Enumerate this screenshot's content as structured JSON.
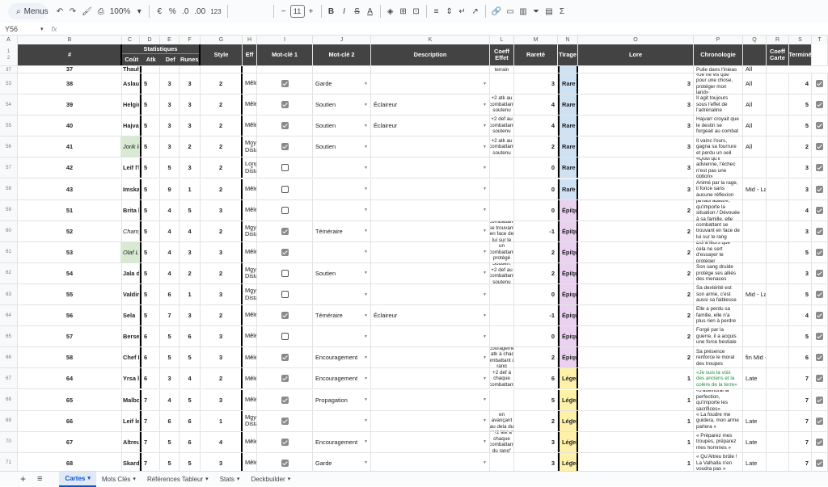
{
  "toolbar": {
    "search": "Menus",
    "zoom": "100%",
    "currency": "€",
    "percent": "%",
    "dec_less": ".0",
    "dec_more": ".00",
    "format_123": "123",
    "font_size": "11",
    "bold": "B",
    "italic": "I",
    "strike": "S",
    "textcolor": "A",
    "sigma": "Σ"
  },
  "formula": {
    "cell_ref": "Y56",
    "fx": "fx"
  },
  "columns": [
    "A",
    "B",
    "C",
    "D",
    "E",
    "F",
    "G",
    "H",
    "I",
    "J",
    "K",
    "L",
    "M",
    "N",
    "O",
    "P",
    "Q",
    "R",
    "S",
    "T"
  ],
  "header": {
    "row1": "1",
    "row2": "2",
    "num": "#",
    "nom": "Nom",
    "stats": "Statistiques",
    "cout": "Coût",
    "atk": "Atk",
    "def": "Def",
    "runes": "Runes",
    "style": "Style",
    "eff": "Eff",
    "mot1": "Mot-clé 1",
    "mot2": "Mot-clé 2",
    "desc": "Description",
    "coeff_effet": "Coeff Effet",
    "rarete": "Rareté",
    "tirage": "Tirage",
    "lore": "Lore",
    "chrono": "Chronologie",
    "coeff_carte": "Coeff Carte",
    "termine": "Terminé"
  },
  "partial_top": {
    "rownum": "37",
    "num": "37",
    "nom": "Thauhu la Charmante",
    "desc": "après avoir phase, afin que le combattant dans son terrain",
    "lore": "Pulie dans l'inieas",
    "chrono": "All"
  },
  "rows": [
    {
      "rownum": "53",
      "num": "38",
      "nom": "Aslaug",
      "cout": "5",
      "atk": "3",
      "def": "3",
      "runes": "2",
      "style": "Mêlée",
      "eff": true,
      "mot1": "Garde",
      "mot2": "",
      "desc": "",
      "coeff": "3",
      "rarete": "Rare",
      "tirage": "3",
      "lore": "«Je ne vis que pour une chose, protéger mon land»",
      "chrono": "All",
      "coeffc": "4",
      "done": true
    },
    {
      "rownum": "54",
      "num": "39",
      "nom": "Helgird le précipité",
      "cout": "5",
      "atk": "3",
      "def": "3",
      "runes": "2",
      "style": "Mêlée",
      "eff": true,
      "mot1": "Soutien",
      "mot2": "Éclaireur",
      "desc": "+2 atk au combattant soutenu",
      "coeff": "4",
      "rarete": "Rare",
      "tirage": "3",
      "lore": "Il agit toujours sous l'effet de l'adrénaline",
      "chrono": "All",
      "coeffc": "5",
      "done": true
    },
    {
      "rownum": "55",
      "num": "40",
      "nom": "Hajvarr",
      "cout": "5",
      "atk": "3",
      "def": "3",
      "runes": "2",
      "style": "Mêlée",
      "eff": true,
      "mot1": "Soutien",
      "mot2": "Éclaireur",
      "desc": "+2 def au combattant soutenu",
      "coeff": "4",
      "rarete": "Rare",
      "tirage": "3",
      "lore": "Hajvarr croyait que le destin se forgeait au combat",
      "chrono": "All",
      "coeffc": "5",
      "done": true
    },
    {
      "rownum": "56",
      "num": "41",
      "nom": "Jorik le Vaillant",
      "cout": "5",
      "atk": "3",
      "def": "2",
      "runes": "2",
      "style": "Moyenne Distance",
      "eff": true,
      "mot1": "Soutien",
      "mot2": "",
      "desc": "+2 atk au combattant soutenu",
      "coeff": "2",
      "rarete": "Rare",
      "tirage": "3",
      "lore": "Il vainc l'ours, gagna sa fourrure et perdu un oeil",
      "chrono": "All",
      "coeffc": "2",
      "done": true,
      "italic": true,
      "green": true
    },
    {
      "rownum": "57",
      "num": "42",
      "nom": "Leif l'héritier",
      "cout": "5",
      "atk": "5",
      "def": "3",
      "runes": "2",
      "style": "Longue Distance",
      "eff": false,
      "mot1": "",
      "mot2": "",
      "desc": "",
      "coeff": "0",
      "rarete": "Rare",
      "tirage": "3",
      "lore": "«Quoi qu'il advienne, l'échec n'est pas une option»",
      "chrono": "",
      "coeffc": "3",
      "done": true
    },
    {
      "rownum": "58",
      "num": "43",
      "nom": "Imskar l'arrogant",
      "cout": "5",
      "atk": "9",
      "def": "1",
      "runes": "2",
      "style": "Mêlée",
      "eff": false,
      "mot1": "",
      "mot2": "",
      "desc": "",
      "coeff": "0",
      "rarete": "Rare",
      "tirage": "3",
      "lore": "Animé par la rage, il fonce sans aucune réflexion",
      "chrono": "Mid - Late",
      "coeffc": "3",
      "done": true
    },
    {
      "rownum": "59",
      "num": "51",
      "nom": "Brita l'Inflexible",
      "cout": "5",
      "atk": "4",
      "def": "5",
      "runes": "3",
      "style": "Mêlée",
      "eff": false,
      "mot1": "",
      "mot2": "",
      "desc": "",
      "coeff": "0",
      "rarete": "Épique",
      "tirage": "2",
      "lore": "Ne se laisse jamais abattre, qu'importe la situation / Dévouée à sa famille, elle l'honore au combat",
      "chrono": "",
      "coeffc": "4",
      "done": true
    },
    {
      "rownum": "60",
      "num": "52",
      "nom": "Champion Njal",
      "cout": "5",
      "atk": "4",
      "def": "4",
      "runes": "2",
      "style": "Moyenne Distance",
      "eff": true,
      "mot1": "Téméraire",
      "mot2": "",
      "desc": "Pousse en avant le combattant se trouvant en face de lui sur le rang suivant.",
      "coeff": "-1",
      "rarete": "Épique",
      "tirage": "2",
      "lore": "Pousse en avant le combattant se trouvant en face de lui sur le rang suivant.",
      "chrono": "",
      "coeffc": "3",
      "done": true,
      "italic": true
    },
    {
      "rownum": "61",
      "num": "53",
      "nom": "Olaf Le Brise-Skjoldr",
      "cout": "5",
      "atk": "4",
      "def": "3",
      "runes": "3",
      "style": "Mêlée",
      "eff": true,
      "mot1": "",
      "mot2": "",
      "desc": "Peut attaquer un combattant protégé par un garde",
      "coeff": "2",
      "rarete": "Épique",
      "tirage": "2",
      "lore": "Dis à leurs que cela ne sert d'essayer te protéger",
      "chrono": "",
      "coeffc": "5",
      "done": true,
      "italic": true,
      "green": true
    },
    {
      "rownum": "62",
      "num": "54",
      "nom": "Jala druide protectrice",
      "cout": "5",
      "atk": "4",
      "def": "2",
      "runes": "2",
      "style": "Moyenne Distance",
      "eff": false,
      "mot1": "Soutien",
      "mot2": "",
      "desc": "Soutien: +2 def au combattant soutenu",
      "coeff": "2",
      "rarete": "Épique",
      "tirage": "2",
      "lore": "Son sang druide protège ses alliés des menaces",
      "chrono": "",
      "coeffc": "3",
      "done": true
    },
    {
      "rownum": "63",
      "num": "55",
      "nom": "Valdimar Lame Rasoir",
      "cout": "5",
      "atk": "6",
      "def": "1",
      "runes": "3",
      "style": "Moyenne Distance",
      "eff": false,
      "mot1": "",
      "mot2": "",
      "desc": "",
      "coeff": "0",
      "rarete": "Épique",
      "tirage": "2",
      "lore": "Sa dextérité est son arme, c'est aussi sa faiblesse",
      "chrono": "Mid - Late",
      "coeffc": "5",
      "done": true
    },
    {
      "rownum": "64",
      "num": "56",
      "nom": "Sela",
      "cout": "5",
      "atk": "7",
      "def": "3",
      "runes": "2",
      "style": "Mêlée",
      "eff": true,
      "mot1": "Téméraire",
      "mot2": "Éclaireur",
      "desc": "",
      "coeff": "-1",
      "rarete": "Épique",
      "tirage": "2",
      "lore": "Elle a perdu sa famille, elle n'a plus rien à perdre",
      "chrono": "",
      "coeffc": "4",
      "done": true
    },
    {
      "rownum": "65",
      "num": "57",
      "nom": "Berserker",
      "cout": "6",
      "atk": "5",
      "def": "6",
      "runes": "3",
      "style": "Mêlée",
      "eff": false,
      "mot1": "",
      "mot2": "",
      "desc": "",
      "coeff": "0",
      "rarete": "Épique",
      "tirage": "2",
      "lore": "Forgé par la guerre, il a acquis une force bestiale",
      "chrono": "",
      "coeffc": "5",
      "done": true
    },
    {
      "rownum": "66",
      "num": "58",
      "nom": "Chef Harald",
      "cout": "6",
      "atk": "5",
      "def": "5",
      "runes": "3",
      "style": "Mêlée",
      "eff": true,
      "mot1": "Encouragement",
      "mot2": "",
      "desc": "Encouragement: +1 atk à chaque combattant du rang",
      "coeff": "2",
      "rarete": "Épique",
      "tirage": "2",
      "lore": "Sa présence renforce le moral des troupes",
      "chrono": "fin Mid - Late",
      "coeffc": "6",
      "done": true
    },
    {
      "rownum": "67",
      "num": "64",
      "nom": "Yrsa l'Archidruide",
      "cout": "6",
      "atk": "3",
      "def": "4",
      "runes": "2",
      "style": "Mêlée",
      "eff": true,
      "mot1": "Encouragement",
      "mot2": "",
      "desc": "+2 atk et +2 def à chaque combattant du rang",
      "coeff": "6",
      "rarete": "Légendaire",
      "tirage": "1",
      "lore": "«Je suis la voix des anciens et la colère de la terre»",
      "chrono": "Late",
      "coeffc": "7",
      "done": true,
      "greenlore": true
    },
    {
      "rownum": "68",
      "num": "65",
      "nom": "Malborn dreki",
      "cout": "7",
      "atk": "4",
      "def": "5",
      "runes": "3",
      "style": "Mêlée",
      "eff": true,
      "mot1": "Propagation",
      "mot2": "",
      "desc": "",
      "coeff": "5",
      "rarete": "Légendaire",
      "tirage": "1",
      "lore": "«J'atteindrai la perfection, qu'importe les sacrifices»",
      "chrono": "",
      "coeffc": "7",
      "done": true
    },
    {
      "rownum": "69",
      "num": "66",
      "nom": "Leif le béni",
      "cout": "7",
      "atk": "6",
      "def": "6",
      "runes": "1",
      "style": "Moyenne Distance",
      "eff": true,
      "mot1": "",
      "mot2": "",
      "desc": "Ne peut pas être défaussé en avançant au dela du front (meurt uniquement si on le tue)",
      "coeff": "2",
      "rarete": "Légendaire",
      "tirage": "1",
      "lore": "« La foudre me guidera, mon arme parlera »",
      "chrono": "Late",
      "coeffc": "7",
      "done": true
    },
    {
      "rownum": "70",
      "num": "67",
      "nom": "Altreu le Jarl",
      "cout": "7",
      "atk": "5",
      "def": "6",
      "runes": "4",
      "style": "Mêlée",
      "eff": true,
      "mot1": "Encouragement",
      "mot2": "",
      "desc": "\"+2 atk à chaque combattant du rang\"",
      "coeff": "3",
      "rarete": "Légendaire",
      "tirage": "1",
      "lore": "« Préparez mes troupes, préparez mes hommes »",
      "chrono": "Late",
      "coeffc": "7",
      "done": true
    },
    {
      "rownum": "71",
      "num": "68",
      "nom": "Skarde l'Irdmen",
      "cout": "7",
      "atk": "5",
      "def": "5",
      "runes": "3",
      "style": "Mêlée",
      "eff": true,
      "mot1": "Garde",
      "mot2": "",
      "desc": "",
      "coeff": "3",
      "rarete": "Légendaire",
      "tirage": "1",
      "lore": "« Qu'Altreu brûle ! La Valhalla n'en voudra pas »",
      "chrono": "Late",
      "coeffc": "7",
      "done": true
    }
  ],
  "tabs": [
    {
      "label": "Cartes",
      "active": true
    },
    {
      "label": "Mots Clés"
    },
    {
      "label": "Références Tableur"
    },
    {
      "label": "Stats"
    },
    {
      "label": "Deckbuilder"
    }
  ],
  "tabbar": {
    "add": "+",
    "all": "≡"
  },
  "colors": {
    "rare": "#cfe2f3",
    "epique": "#ead1f0",
    "legendaire": "#fff2a8",
    "header": "#434343"
  }
}
